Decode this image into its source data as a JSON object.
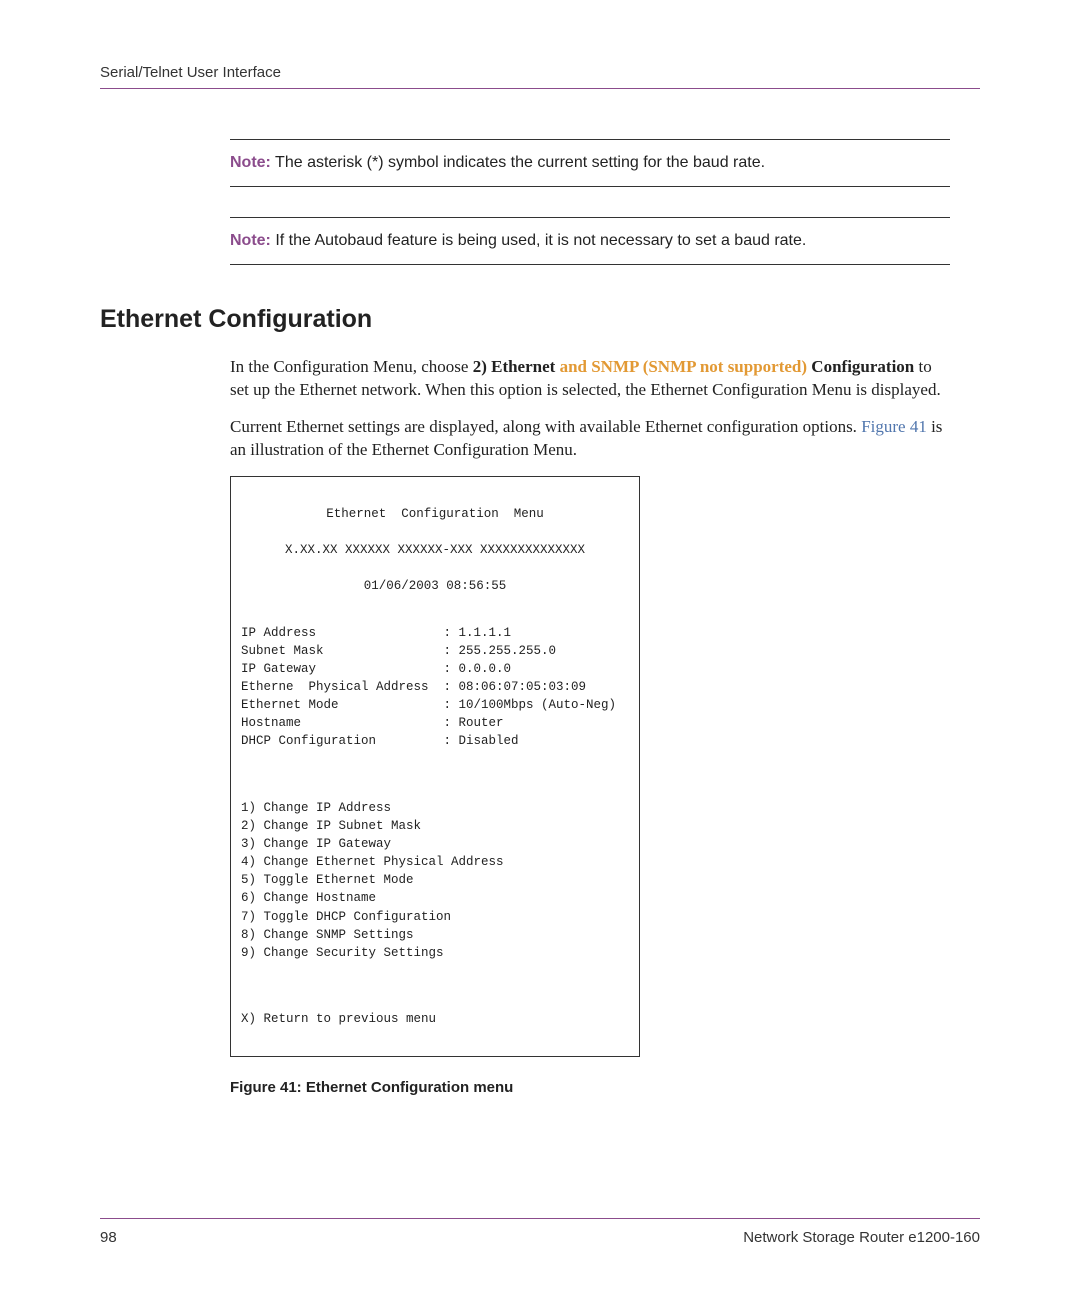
{
  "header": {
    "breadcrumb": "Serial/Telnet User Interface"
  },
  "notes": {
    "label": "Note:",
    "note1": " The asterisk (*) symbol indicates the current setting for the baud rate.",
    "note2": " If the Autobaud feature is being used, it is not necessary to set a baud rate."
  },
  "section": {
    "heading": "Ethernet Configuration"
  },
  "para1": {
    "pre": "In the Configuration Menu, choose ",
    "bold1": "2) Ethernet ",
    "amber": "and SNMP (SNMP not supported) ",
    "bold2": "Configuration",
    "post": " to set up the Ethernet network. When this option is selected, the Ethernet Configuration Menu is displayed."
  },
  "para2": {
    "pre": "Current Ethernet settings are displayed, along with available Ethernet configuration options. ",
    "link": "Figure 41",
    "post": " is an illustration of the Ethernet Configuration Menu."
  },
  "terminal": {
    "title": "Ethernet  Configuration  Menu",
    "version": "X.XX.XX XXXXXX XXXXXX-XXX XXXXXXXXXXXXXX",
    "datetime": "01/06/2003 08:56:55",
    "settings": [
      {
        "label": "IP Address",
        "value": "1.1.1.1"
      },
      {
        "label": "Subnet Mask",
        "value": "255.255.255.0"
      },
      {
        "label": "IP Gateway",
        "value": "0.0.0.0"
      },
      {
        "label": "Etherne  Physical Address",
        "value": "08:06:07:05:03:09"
      },
      {
        "label": "Ethernet Mode",
        "value": "10/100Mbps (Auto-Neg)"
      },
      {
        "label": "Hostname",
        "value": "Router"
      },
      {
        "label": "DHCP Configuration",
        "value": "Disabled"
      }
    ],
    "options": [
      "1) Change IP Address",
      "2) Change IP Subnet Mask",
      "3) Change IP Gateway",
      "4) Change Ethernet Physical Address",
      "5) Toggle Ethernet Mode",
      "6) Change Hostname",
      "7) Toggle DHCP Configuration",
      "8) Change SNMP Settings",
      "9) Change Security Settings"
    ],
    "return": "X) Return to previous menu"
  },
  "figureCaption": "Figure 41:  Ethernet Configuration menu",
  "footer": {
    "pageNum": "98",
    "docTitle": "Network Storage Router e1200-160"
  }
}
